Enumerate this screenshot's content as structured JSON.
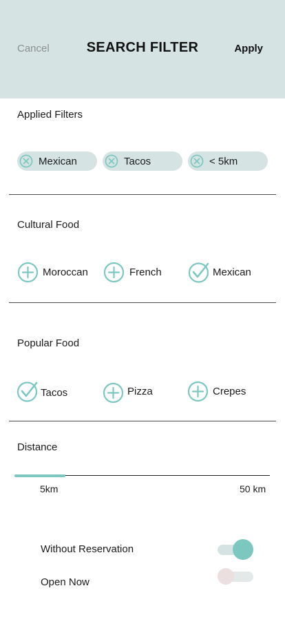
{
  "header": {
    "cancel_label": "Cancel",
    "title": "SEARCH FILTER",
    "apply_label": "Apply",
    "background": "#d5e4e3"
  },
  "applied_filters": {
    "title": "Applied Filters",
    "chips": [
      {
        "label": "Mexican",
        "icon": "remove-circle-icon"
      },
      {
        "label": "Tacos",
        "icon": "remove-circle-icon"
      },
      {
        "label": "< 5km",
        "icon": "remove-circle-icon"
      }
    ]
  },
  "cultural_food": {
    "title": "Cultural Food",
    "options": [
      {
        "label": "Moroccan",
        "selected": false
      },
      {
        "label": "French",
        "selected": false
      },
      {
        "label": "Mexican",
        "selected": true
      }
    ]
  },
  "popular_food": {
    "title": "Popular Food",
    "options": [
      {
        "label": "Tacos",
        "selected": true
      },
      {
        "label": "Pizza",
        "selected": false
      },
      {
        "label": "Crepes",
        "selected": false
      }
    ]
  },
  "distance": {
    "title": "Distance",
    "min_label": "5km",
    "max_label": "50 km",
    "min_value": 5,
    "max_value": 50,
    "selected_fraction": 0.2
  },
  "toggles": [
    {
      "label": "Without Reservation",
      "on": true
    },
    {
      "label": "Open Now",
      "on": false
    }
  ],
  "colors": {
    "accent": "#7cc8c1",
    "chip_bg": "#d5e4e3"
  }
}
